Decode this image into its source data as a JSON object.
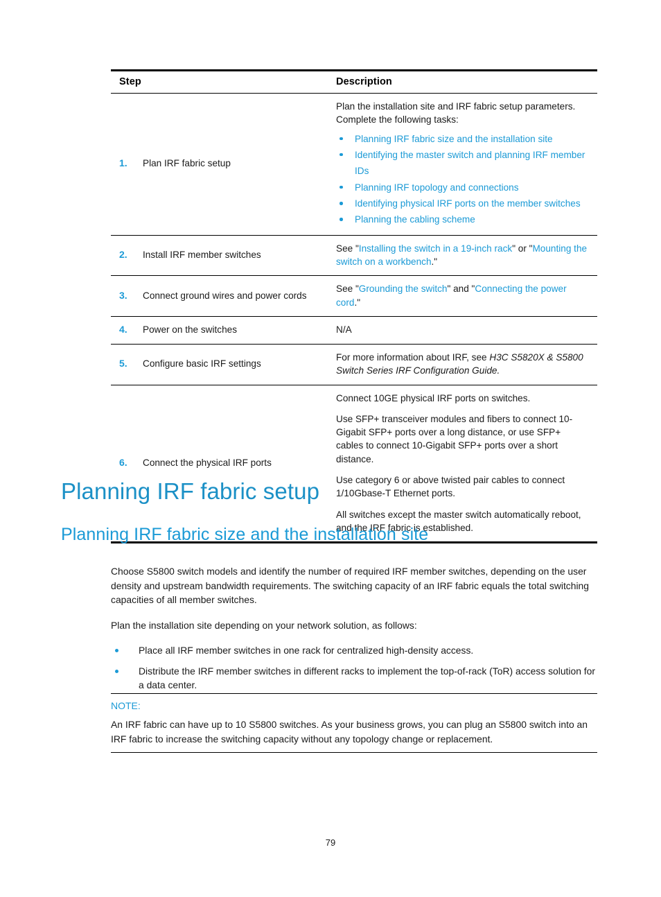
{
  "colors": {
    "link_blue": "#1b9ad6",
    "heading_blue": "#1b90c6",
    "text_black": "#1a1a1a",
    "rule_black": "#000000"
  },
  "table": {
    "headers": {
      "step": "Step",
      "description": "Description"
    },
    "rows": [
      {
        "number": "1.",
        "label": "Plan IRF fabric setup",
        "description_intro": "Plan the installation site and IRF fabric setup parameters. Complete the following tasks:",
        "links": [
          "Planning IRF fabric size and the installation site",
          "Identifying the master switch and planning IRF member IDs",
          "Planning IRF topology and connections",
          "Identifying physical IRF ports on the member switches",
          "Planning the cabling scheme"
        ]
      },
      {
        "number": "2.",
        "label": "Install IRF member switches",
        "desc_pre": "See \"",
        "desc_link1": "Installing the switch in a 19-inch rack",
        "desc_mid": "\" or \"",
        "desc_link2": "Mounting the switch on a workbench",
        "desc_post": ".\""
      },
      {
        "number": "3.",
        "label": "Connect ground wires and power cords",
        "desc_pre": "See \"",
        "desc_link1": "Grounding the switch",
        "desc_mid": "\" and \"",
        "desc_link2": "Connecting the power cord",
        "desc_post": ".\""
      },
      {
        "number": "4.",
        "label": "Power on the switches",
        "description": "N/A"
      },
      {
        "number": "5.",
        "label": "Configure basic IRF settings",
        "desc_pre": "For more information about IRF, see ",
        "desc_italic": "H3C S5820X & S5800 Switch Series IRF Configuration Guide.",
        "desc_post": ""
      },
      {
        "number": "6.",
        "label": "Connect the physical IRF ports",
        "paragraphs": [
          "Connect 10GE physical IRF ports on switches.",
          "Use SFP+ transceiver modules and fibers to connect 10-Gigabit SFP+ ports over a long distance, or use SFP+ cables to connect 10-Gigabit SFP+ ports over a short distance.",
          "Use category 6 or above twisted pair cables to connect 1/10Gbase-T Ethernet ports.",
          "All switches except the master switch automatically reboot, and the IRF fabric is established."
        ]
      }
    ]
  },
  "headings": {
    "h1": "Planning IRF fabric setup",
    "h2": "Planning IRF fabric size and the installation site"
  },
  "body": {
    "paragraph1": "Choose S5800 switch models and identify the number of required IRF member switches, depending on the user density and upstream bandwidth requirements. The switching capacity of an IRF fabric equals the total switching capacities of all member switches.",
    "paragraph2": "Plan the installation site depending on your network solution, as follows:",
    "bullets": [
      "Place all IRF member switches in one rack for centralized high-density access.",
      "Distribute the IRF member switches in different racks to implement the top-of-rack (ToR) access solution for a data center."
    ]
  },
  "note": {
    "title": "NOTE:",
    "text": "An IRF fabric can have up to 10 S5800 switches. As your business grows, you can plug an S5800 switch into an IRF fabric to increase the switching capacity without any topology change or replacement."
  },
  "footer": {
    "page_number": "79"
  }
}
